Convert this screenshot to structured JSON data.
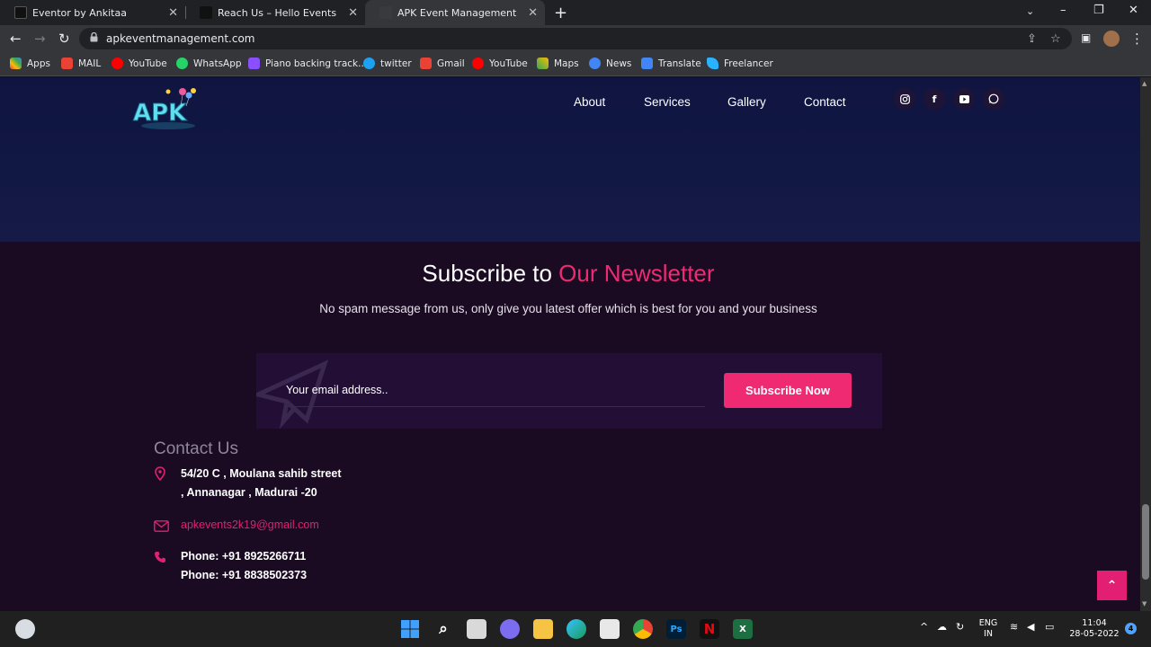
{
  "browser": {
    "tabs": [
      {
        "title": "Eventor by Ankitaa"
      },
      {
        "title": "Reach Us – Hello Events"
      },
      {
        "title": "APK Event Management"
      }
    ],
    "url": "apkeventmanagement.com",
    "bookmarks": [
      {
        "label": "Apps",
        "icon": "apps-grid-icon",
        "color": "#4285f4"
      },
      {
        "label": "MAIL",
        "icon": "gmail-icon",
        "color": "#ea4335"
      },
      {
        "label": "YouTube",
        "icon": "youtube-icon",
        "color": "#ff0000"
      },
      {
        "label": "WhatsApp",
        "icon": "whatsapp-icon",
        "color": "#25d366"
      },
      {
        "label": "Piano backing track...",
        "icon": "piano-icon",
        "color": "#8a4fff"
      },
      {
        "label": "twitter",
        "icon": "twitter-icon",
        "color": "#1da1f2"
      },
      {
        "label": "Gmail",
        "icon": "gmail-icon",
        "color": "#ea4335"
      },
      {
        "label": "YouTube",
        "icon": "youtube-icon",
        "color": "#ff0000"
      },
      {
        "label": "Maps",
        "icon": "maps-icon",
        "color": "#34a853"
      },
      {
        "label": "News",
        "icon": "news-icon",
        "color": "#4285f4"
      },
      {
        "label": "Translate",
        "icon": "translate-icon",
        "color": "#4285f4"
      },
      {
        "label": "Freelancer",
        "icon": "freelancer-icon",
        "color": "#29b2fe"
      }
    ]
  },
  "site": {
    "nav": [
      "About",
      "Services",
      "Gallery",
      "Contact"
    ],
    "social": [
      "instagram-icon",
      "facebook-icon",
      "youtube-icon",
      "whatsapp-icon"
    ],
    "newsletter": {
      "title_prefix": "Subscribe to ",
      "title_accent": "Our Newsletter",
      "subtitle": "No spam message from us, only give you latest offer which is best for you and your business",
      "placeholder": "Your email address..",
      "button": "Subscribe Now"
    },
    "contact": {
      "title": "Contact Us",
      "address_line1": "54/20 C , Moulana sahib street",
      "address_line2": ", Annanagar , Madurai -20",
      "email": "apkevents2k19@gmail.com",
      "phone1": "Phone: +91 8925266711",
      "phone2": "Phone: +91 8838502373"
    },
    "accent_color": "#ef2a73"
  },
  "taskbar": {
    "lang_line1": "ENG",
    "lang_line2": "IN",
    "time": "11:04",
    "date": "28-05-2022",
    "notifications": "4"
  }
}
